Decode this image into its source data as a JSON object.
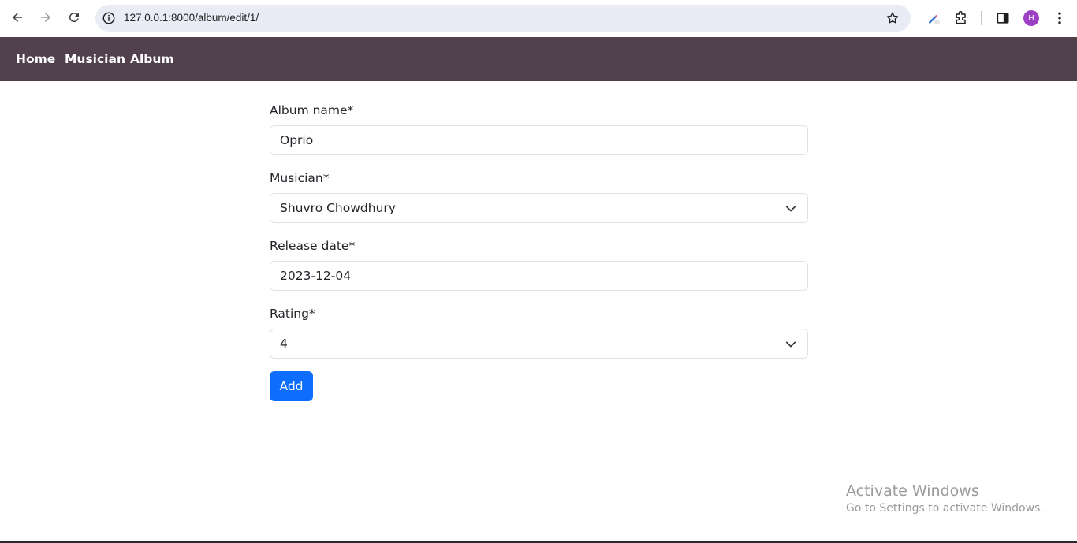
{
  "browser": {
    "url": "127.0.0.1:8000/album/edit/1/",
    "profile_initial": "H"
  },
  "navbar": {
    "items": [
      {
        "label": "Home"
      },
      {
        "label": "Musician"
      },
      {
        "label": "Album"
      }
    ]
  },
  "form": {
    "album_name": {
      "label": "Album name*",
      "value": "Oprio"
    },
    "musician": {
      "label": "Musician*",
      "value": "Shuvro Chowdhury"
    },
    "release_date": {
      "label": "Release date*",
      "value": "2023-12-04"
    },
    "rating": {
      "label": "Rating*",
      "value": "4"
    },
    "submit_label": "Add"
  },
  "watermark": {
    "title": "Activate Windows",
    "subtitle": "Go to Settings to activate Windows."
  },
  "colors": {
    "navbar": "#51414c",
    "primary_button": "#0d6efd"
  }
}
